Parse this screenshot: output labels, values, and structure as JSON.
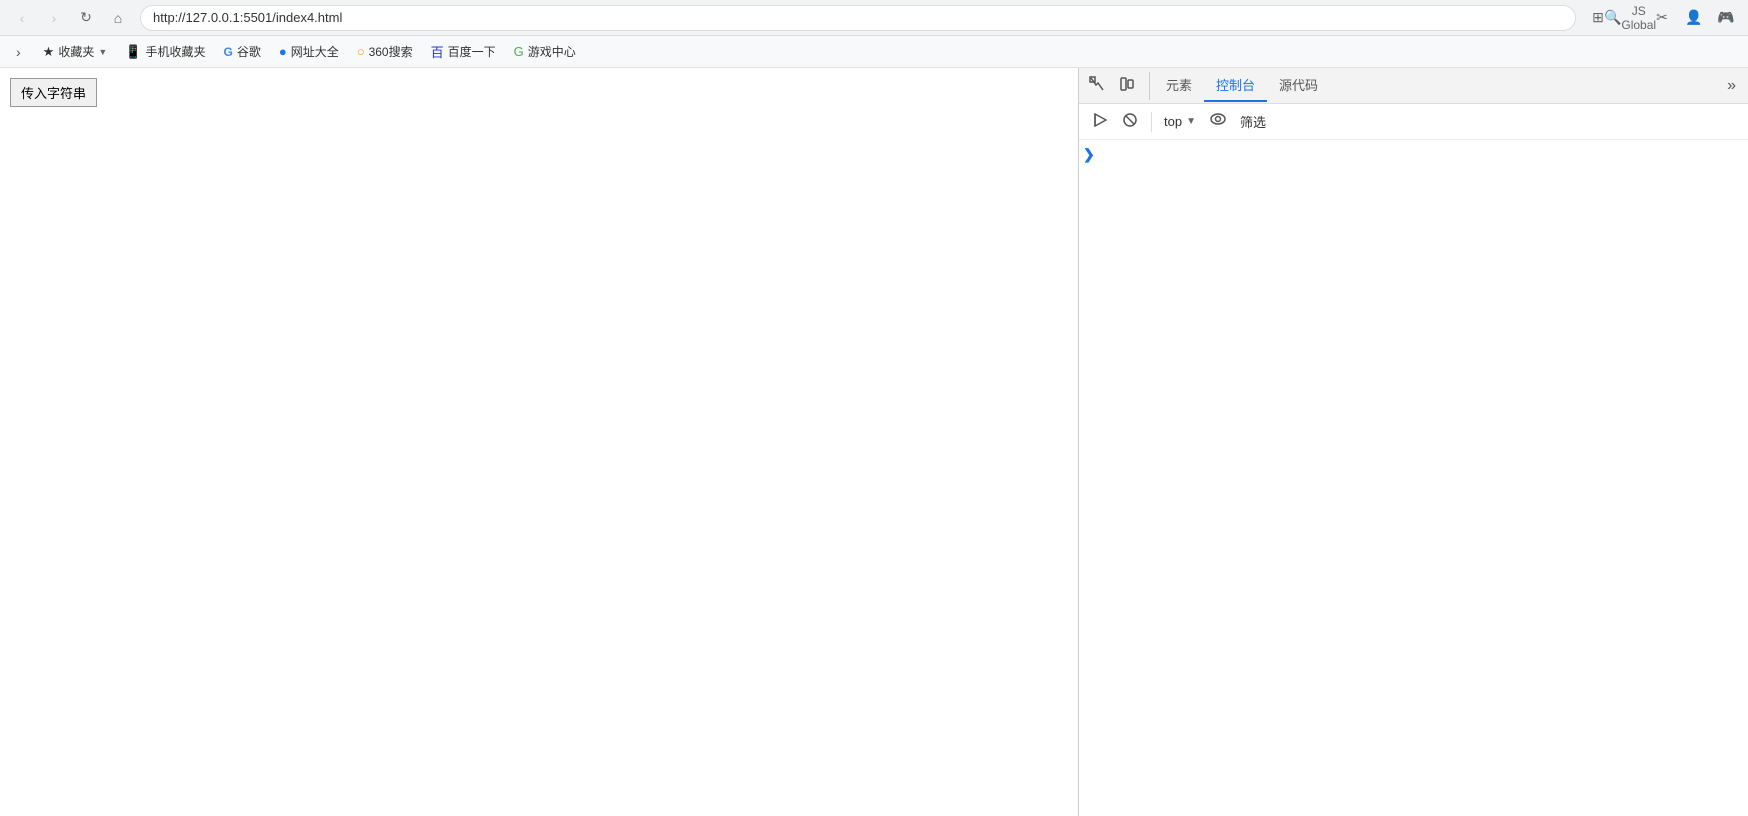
{
  "browser": {
    "url": "http://127.0.0.1:5501/index4.html",
    "nav": {
      "back_label": "‹",
      "forward_label": "›",
      "reload_label": "↻",
      "home_label": "⌂"
    },
    "actions": {
      "extensions_label": "⊞",
      "profile_label": "👤",
      "menu_label": "⋮",
      "search_placeholder": "JS Global"
    }
  },
  "bookmarks": {
    "toggle_label": "›",
    "items": [
      {
        "id": "favorites",
        "icon": "★",
        "label": "收藏夹",
        "has_arrow": true
      },
      {
        "id": "mobile",
        "icon": "📱",
        "label": "手机收藏夹",
        "has_arrow": false
      },
      {
        "id": "google",
        "icon": "G",
        "label": "谷歌",
        "has_arrow": false
      },
      {
        "id": "hao123",
        "icon": "●",
        "label": "网址大全",
        "has_arrow": false
      },
      {
        "id": "360search",
        "icon": "○",
        "label": "360搜索",
        "has_arrow": false
      },
      {
        "id": "baidu",
        "icon": "百",
        "label": "百度一下",
        "has_arrow": false
      },
      {
        "id": "games",
        "icon": "G",
        "label": "游戏中心",
        "has_arrow": false
      }
    ]
  },
  "page": {
    "button_label": "传入字符串"
  },
  "devtools": {
    "tabs": [
      {
        "id": "elements",
        "label": "元素"
      },
      {
        "id": "console",
        "label": "控制台"
      },
      {
        "id": "sources",
        "label": "源代码"
      }
    ],
    "active_tab": "console",
    "more_label": "»",
    "toolbar": {
      "run_btn": "▶",
      "block_btn": "⊘",
      "context": "top",
      "context_arrow": "▼",
      "eye_label": "👁",
      "filter_label": "筛选"
    },
    "console_chevron": "❯"
  }
}
